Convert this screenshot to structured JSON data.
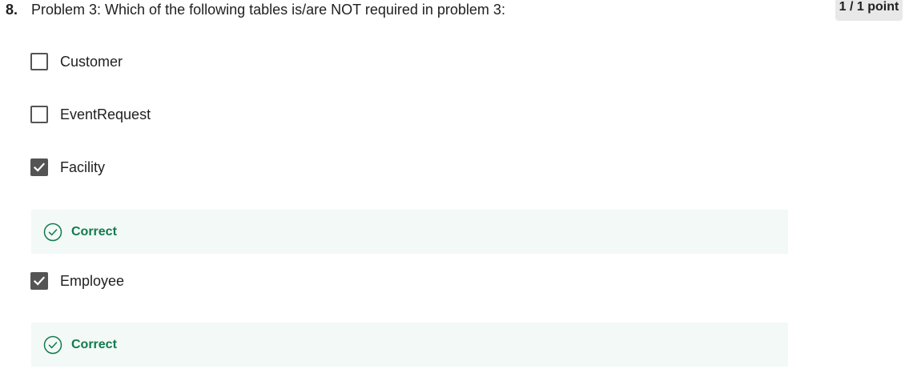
{
  "question": {
    "number": "8.",
    "text": "Problem 3: Which of the following tables is/are NOT required in problem 3:",
    "points": "1 / 1 point"
  },
  "options": [
    {
      "label": "Customer",
      "checked": false
    },
    {
      "label": "EventRequest",
      "checked": false
    },
    {
      "label": "Facility",
      "checked": true,
      "feedback": "Correct"
    },
    {
      "label": "Employee",
      "checked": true,
      "feedback": "Correct"
    }
  ],
  "colors": {
    "checkbox": "#545454",
    "feedback_bg": "#f2f9f6",
    "correct_text": "#137a4e",
    "badge_bg": "#e8e8e8"
  },
  "icons": {
    "checkbox_checked": "check-icon",
    "feedback": "check-circle-icon"
  }
}
